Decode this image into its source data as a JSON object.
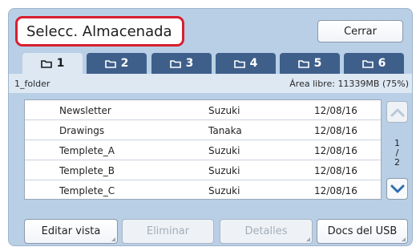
{
  "header": {
    "title": "Selecc. Almacenada",
    "close_label": "Cerrar"
  },
  "tabs": [
    {
      "label": "1",
      "active": true,
      "icon": "folder-icon"
    },
    {
      "label": "2",
      "active": false,
      "icon": "folder-icon"
    },
    {
      "label": "3",
      "active": false,
      "icon": "folder-icon"
    },
    {
      "label": "4",
      "active": false,
      "icon": "folder-icon"
    },
    {
      "label": "5",
      "active": false,
      "icon": "folder-icon"
    },
    {
      "label": "6",
      "active": false,
      "icon": "folder-icon"
    }
  ],
  "info": {
    "folder_name": "1_folder",
    "free_space": "Área libre: 11339MB (75%)"
  },
  "files": [
    {
      "name": "Newsletter",
      "user": "Suzuki",
      "date": "12/08/16"
    },
    {
      "name": "Drawings",
      "user": "Tanaka",
      "date": "12/08/16"
    },
    {
      "name": "Templete_A",
      "user": "Suzuki",
      "date": "12/08/16"
    },
    {
      "name": "Templete_B",
      "user": "Suzuki",
      "date": "12/08/16"
    },
    {
      "name": "Templete_C",
      "user": "Suzuki",
      "date": "12/08/16"
    }
  ],
  "pagination": {
    "current": "1",
    "separator": "/",
    "total": "2"
  },
  "buttons": {
    "edit_view": "Editar vista",
    "delete": "Eliminar",
    "details": "Detalles",
    "usb_docs": "Docs del USB"
  },
  "colors": {
    "accent_red": "#d81f2f",
    "tab_blue": "#3f5f8b",
    "panel_blue": "#b9cfe6",
    "scroll_arrow": "#2f6fb0"
  }
}
